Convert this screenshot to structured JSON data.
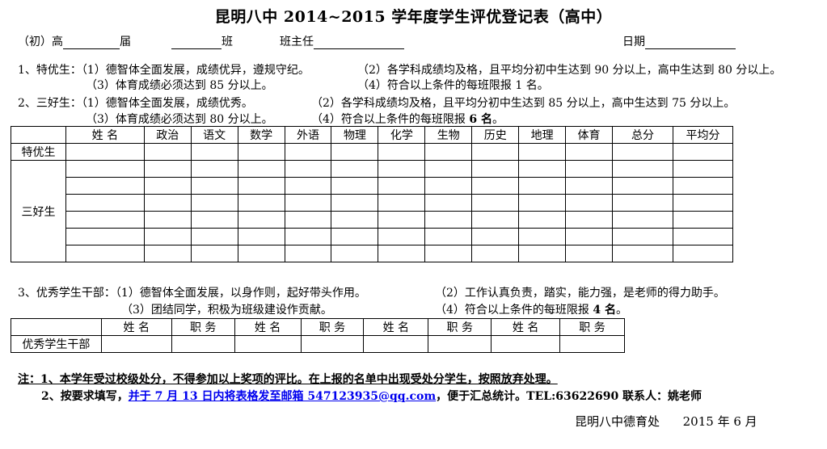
{
  "title": "昆明八中 2014~2015 学年度学生评优登记表（高中）",
  "header": {
    "grade_label": "（初）高",
    "session_label": "届",
    "class_label": "班",
    "teacher_label": "班主任",
    "date_label": "日期"
  },
  "criteria": {
    "excellent_1": "1、特优生：（1）德智体全面发展，成绩优异，遵规守纪。",
    "excellent_2": "（2）各学科成绩均及格，且平均分初中生达到 90 分以上，高中生达到 80 分以上。",
    "excellent_3": "（3）体育成绩必须达到 85 分以上。",
    "excellent_4": "（4）符合以上条件的每班限报 1 名。",
    "merit_1": "2、三好生：（1）德智体全面发展，成绩优秀。",
    "merit_2": "（2）各学科成绩均及格，且平均分初中生达到 85 分以上，高中生达到 75 分以上。",
    "merit_3": "（3）体育成绩必须达到 80 分以上。",
    "merit_4_prefix": "（4）符合以上条件的每班限报 ",
    "merit_4_bold": "6 名",
    "merit_4_suffix": "。"
  },
  "main_table": {
    "columns": [
      "姓 名",
      "政治",
      "语文",
      "数学",
      "外语",
      "物理",
      "化学",
      "生物",
      "历史",
      "地理",
      "体育",
      "总分",
      "平均分"
    ],
    "row_excellent": "特优生",
    "row_merit": "三好生"
  },
  "cadre": {
    "line_1": "3、优秀学生干部：（1）德智体全面发展，以身作则，起好带头作用。",
    "line_2": "（2）工作认真负责，踏实，能力强，是老师的得力助手。",
    "line_3": "（3）团结同学，积极为班级建设作贡献。",
    "line_4_prefix": "（4）符合以上条件的每班限报 ",
    "line_4_bold": "4 名",
    "line_4_suffix": "。",
    "table_row_label": "优秀学生干部",
    "name_header": "姓 名",
    "duty_header": "职 务"
  },
  "notes": {
    "note_1": "注：1、本学年受过校级处分，不得参加以上奖项的评比。在上报的名单中出现受处分学生，按照放弃处理。",
    "note_2_prefix": "2、按要求填写，",
    "note_2_link": "并于 7 月 13 日内将表格发至邮箱 547123935@qq.com",
    "note_2_suffix": "，便于汇总统计。TEL:63622690    联系人：姚老师"
  },
  "footer": {
    "office": "昆明八中德育处",
    "date": "2015 年 6 月"
  }
}
